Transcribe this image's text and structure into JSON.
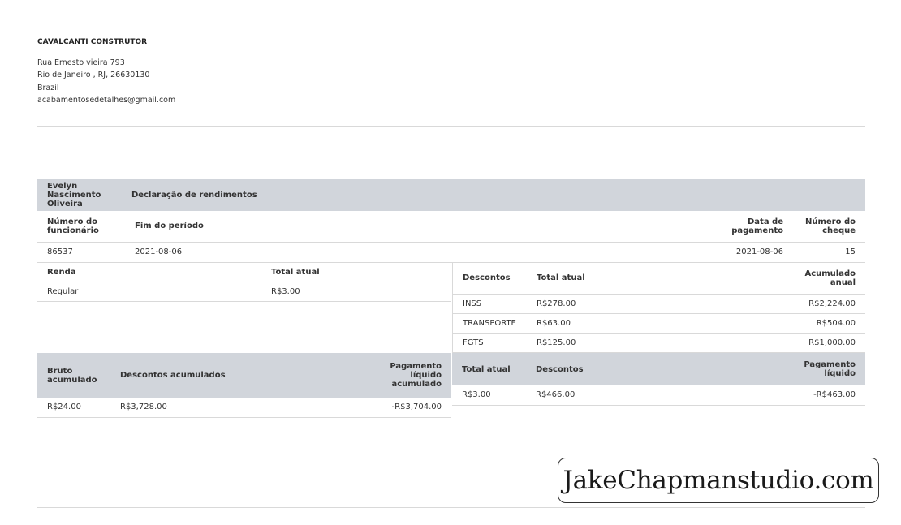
{
  "company": {
    "name": "CAVALCANTI CONSTRUTOR",
    "address_line1": "Rua Ernesto vieira 793",
    "address_line2": "Rio de Janeiro , RJ, 26630130",
    "country": "Brazil",
    "email": "acabamentosedetalhes@gmail.com"
  },
  "statement": {
    "employee_name": "Evelyn Nascimento Oliveira",
    "title": "Declaração de rendimentos",
    "headers": {
      "employee_number": "Número do funcionário",
      "period_end": "Fim do período",
      "payment_date": "Data de pagamento",
      "check_number": "Número do cheque"
    },
    "values": {
      "employee_number": "86537",
      "period_end": "2021-08-06",
      "payment_date": "2021-08-06",
      "check_number": "15"
    }
  },
  "income": {
    "headers": {
      "label": "Renda",
      "current": "Total atual"
    },
    "rows": [
      {
        "label": "Regular",
        "current": "R$3.00"
      }
    ]
  },
  "deductions": {
    "headers": {
      "label": "Descontos",
      "current": "Total atual",
      "ytd": "Acumulado anual"
    },
    "rows": [
      {
        "label": "INSS",
        "current": "R$278.00",
        "ytd": "R$2,224.00"
      },
      {
        "label": "TRANSPORTE",
        "current": "R$63.00",
        "ytd": "R$504.00"
      },
      {
        "label": "FGTS",
        "current": "R$125.00",
        "ytd": "R$1,000.00"
      }
    ]
  },
  "accumulated": {
    "headers": {
      "gross": "Bruto acumulado",
      "deductions": "Descontos acumulados",
      "net": "Pagamento líquido acumulado"
    },
    "values": {
      "gross": "R$24.00",
      "deductions": "R$3,728.00",
      "net": "-R$3,704.00"
    }
  },
  "current_totals": {
    "headers": {
      "total": "Total atual",
      "deductions": "Descontos",
      "net": "Pagamento líquido"
    },
    "values": {
      "total": "R$3.00",
      "deductions": "R$466.00",
      "net": "-R$463.00"
    }
  },
  "watermark": {
    "text": "JakeChapmanstudio.com"
  }
}
